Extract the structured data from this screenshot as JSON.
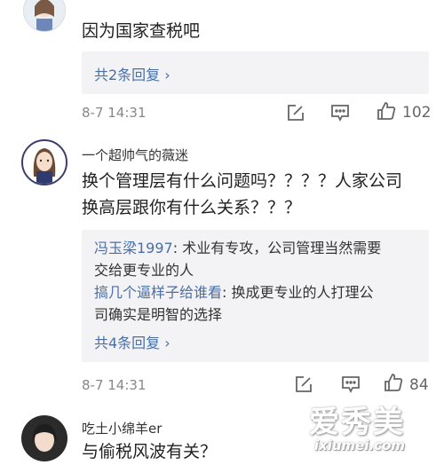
{
  "comments": [
    {
      "username": "",
      "text": "因为国家查税吧",
      "more_replies": "共2条回复 ›",
      "time": "8-7 14:31",
      "likes": "102",
      "replies": []
    },
    {
      "username": "一个超帅气的薇迷",
      "text_lines": [
        "换个管理层有什么问题吗？？？？人家公司",
        "换高层跟你有什么关系？？？"
      ],
      "replies": [
        {
          "author": "冯玉梁1997",
          "sep": ": ",
          "lines": [
            "术业有专攻，公司管理当然需要",
            "交给更专业的人"
          ]
        },
        {
          "author": "搞几个逼样子给谁看",
          "sep": ": ",
          "lines": [
            "换成更专业的人打理公",
            "司确实是明智的选择"
          ]
        }
      ],
      "more_replies": "共4条回复 ›",
      "time": "8-7 14:31",
      "likes": "84"
    },
    {
      "username": "吃土小绵羊er",
      "text": "与偷税风波有关？",
      "replies": []
    }
  ],
  "icons": {
    "edit": "edit-icon",
    "comment": "comment-icon",
    "like": "thumbs-up-icon"
  },
  "watermark": {
    "logo": "爱秀美",
    "domain": "ixiumei.com"
  },
  "colors": {
    "reply_author": "#4a6fa5",
    "reply_bg": "#f3f3f5",
    "meta": "#888888"
  }
}
